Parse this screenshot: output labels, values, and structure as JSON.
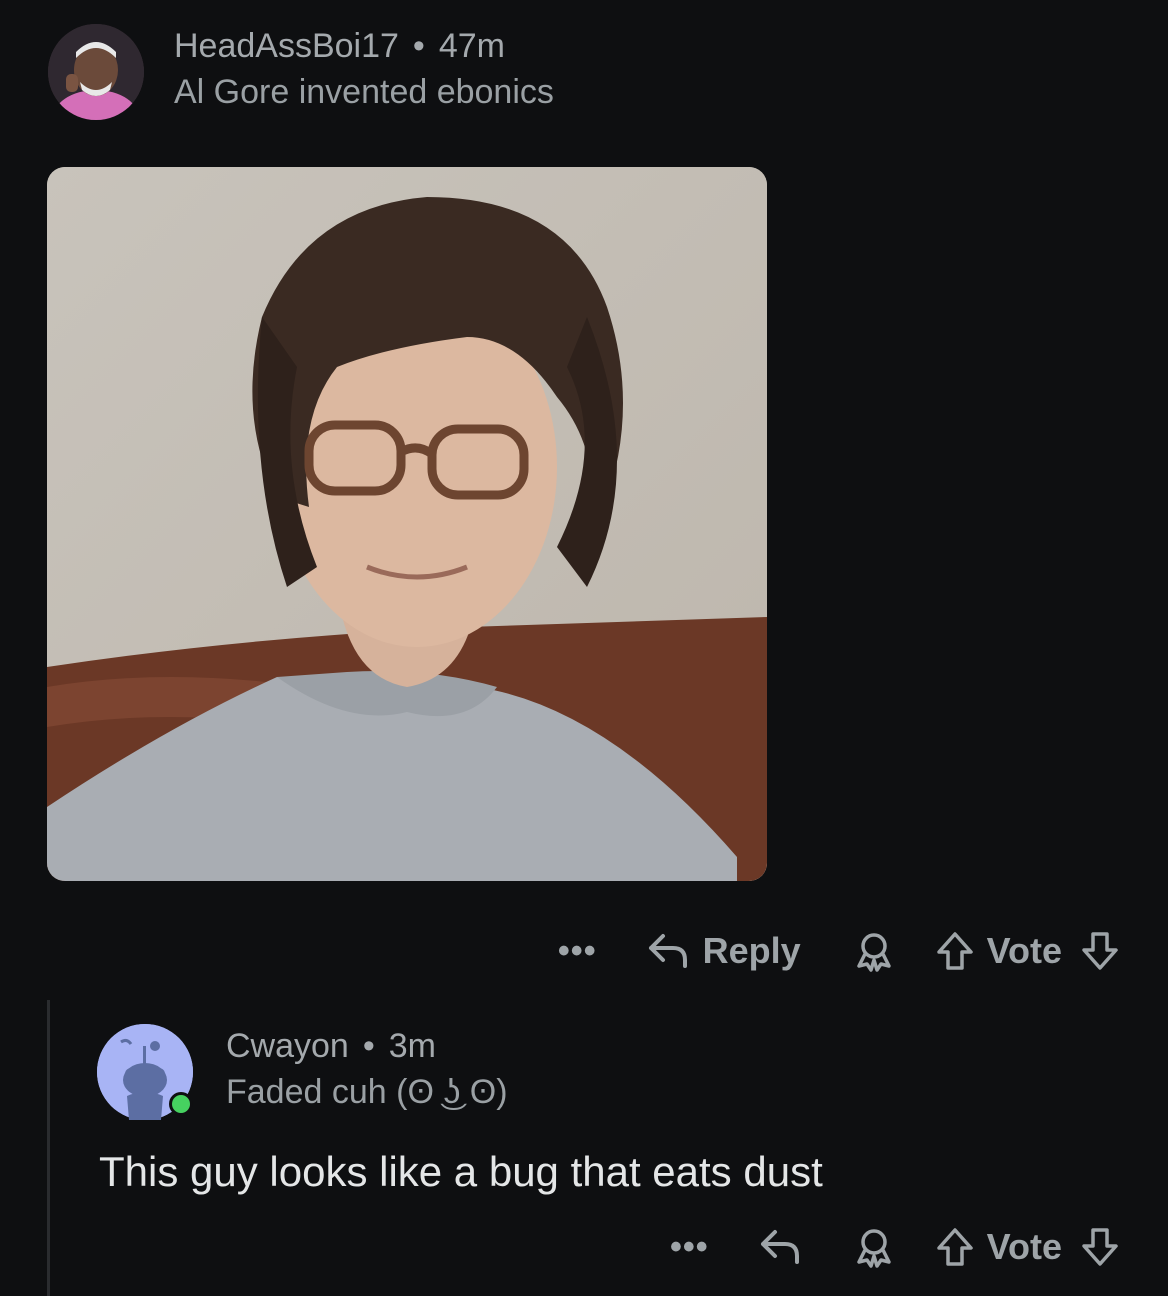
{
  "comment1": {
    "username": "HeadAssBoi17",
    "separator": "•",
    "age": "47m",
    "flair": "Al Gore invented ebonics",
    "avatar_icon": "user-avatar-photo",
    "image_icon": "selfie-photo",
    "actions": {
      "more_label": "•••",
      "reply_label": "Reply",
      "vote_label": "Vote"
    }
  },
  "comment2": {
    "username": "Cwayon",
    "separator": "•",
    "age": "3m",
    "flair": "Faded cuh (ʘ ͜ʖ ʘ)",
    "avatar_icon": "snoo-avatar",
    "online_color": "#46d160",
    "body": "This guy looks like a bug that eats dust",
    "actions": {
      "more_label": "•••",
      "vote_label": "Vote"
    }
  },
  "colors": {
    "background": "#0e0f11",
    "meta_text": "#a4a9ad",
    "action_text": "#9ea4a8",
    "body_text": "#e4e6e7"
  }
}
